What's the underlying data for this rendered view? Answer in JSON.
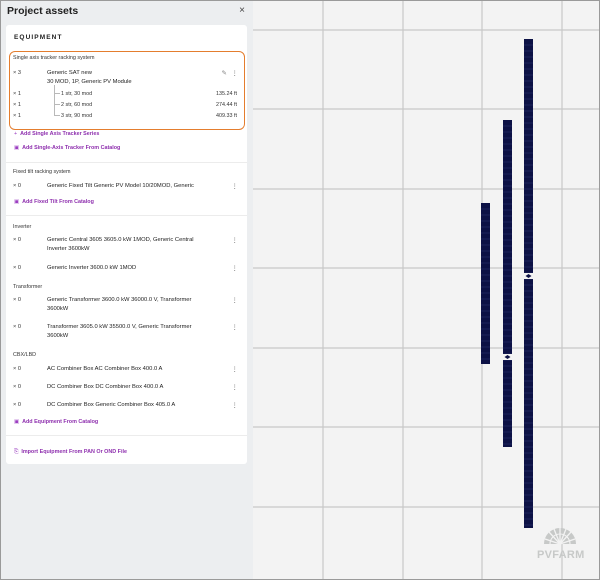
{
  "panel": {
    "title": "Project assets",
    "close_glyph": "×",
    "heading": "EQUIPMENT"
  },
  "sat": {
    "section_title": "Single axis tracker racking system",
    "qty": "× 3",
    "name": "Generic SAT new",
    "detail": "30 MOD, 1P, Generic PV Module",
    "edit_icon": "pencil-icon",
    "rows": [
      {
        "qty": "× 1",
        "label": "1 str, 30 mod",
        "value": "135.24 ft"
      },
      {
        "qty": "× 1",
        "label": "2 str, 60 mod",
        "value": "274.44 ft"
      },
      {
        "qty": "× 1",
        "label": "3 str, 90 mod",
        "value": "409.33 ft"
      }
    ],
    "add_series": "Add Single Axis Tracker Series",
    "add_catalog": "Add Single-Axis Tracker From Catalog"
  },
  "fixed": {
    "section_title": "Fixed tilt racking system",
    "qty": "× 0",
    "name": "Generic Fixed Tilt Generic PV Model 10/20MOD, Generic",
    "add_catalog": "Add Fixed Tilt From Catalog"
  },
  "inverter": {
    "section_title": "Inverter",
    "items": [
      {
        "qty": "× 0",
        "line1": "Generic Central 3605 3605.0 kW 1MOD, Generic Central",
        "line2": "Inverter 3600kW"
      },
      {
        "qty": "× 0",
        "line1": "Generic Inverter 3600.0 kW 1MOD",
        "line2": ""
      }
    ]
  },
  "transformer": {
    "section_title": "Transformer",
    "items": [
      {
        "qty": "× 0",
        "line1": "Generic Transformer 3600.0 kW 36000.0 V, Transformer",
        "line2": "3600kW"
      },
      {
        "qty": "× 0",
        "line1": "Transformer 3605.0 kW 35500.0 V, Generic Transformer",
        "line2": "3600kW"
      }
    ]
  },
  "cbx": {
    "section_title": "CBX/LBD",
    "items": [
      {
        "qty": "× 0",
        "name": "AC Combiner Box AC Combiner Box 400.0 A"
      },
      {
        "qty": "× 0",
        "name": "DC Combiner Box DC Combiner Box 400.0 A"
      },
      {
        "qty": "× 0",
        "name": "DC Combiner Box Generic Combiner Box 405.0 A"
      }
    ],
    "add_catalog": "Add Equipment From Catalog"
  },
  "import_link": "Import Equipment From PAN Or OND File",
  "icons": {
    "kebab": "kebab-menu-icon",
    "plus": "plus-icon",
    "catalog": "catalog-icon",
    "import": "import-file-icon"
  },
  "colors": {
    "accent_purple": "#8e2fae",
    "highlight_orange": "#e47d2e",
    "tracker_navy": "#0c1145",
    "grid_line": "#c8c8c8",
    "map_background": "#f3f3f3"
  },
  "brand": {
    "label": "PVFARM"
  }
}
